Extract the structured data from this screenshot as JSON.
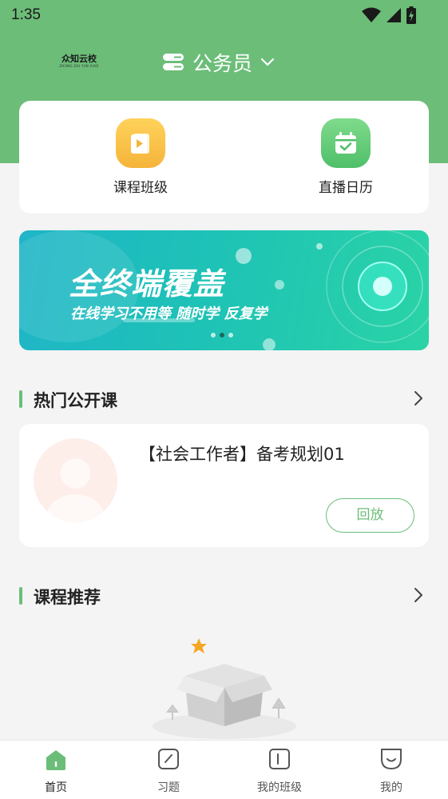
{
  "status_bar": {
    "time": "1:35"
  },
  "header": {
    "logo_text": "众知云校",
    "logo_sub": "ZHONG ZHI YUN XIAO",
    "category": "公务员"
  },
  "quick_actions": [
    {
      "label": "课程班级",
      "icon": "video-book-icon"
    },
    {
      "label": "直播日历",
      "icon": "calendar-check-icon"
    }
  ],
  "banner": {
    "title": "全终端覆盖",
    "subtitle": "在线学习不用等  随时学  反复学",
    "slides": 3,
    "active_slide": 2
  },
  "hot_section": {
    "title": "热门公开课",
    "course": {
      "title": "【社会工作者】备考规划01",
      "button": "回放"
    }
  },
  "recommend_section": {
    "title": "课程推荐"
  },
  "tabbar": {
    "tabs": [
      {
        "label": "首页",
        "active": true
      },
      {
        "label": "习题",
        "active": false
      },
      {
        "label": "我的班级",
        "active": false
      },
      {
        "label": "我的",
        "active": false
      }
    ]
  },
  "colors": {
    "primary": "#6cbd78",
    "background": "#f4f4f4"
  }
}
